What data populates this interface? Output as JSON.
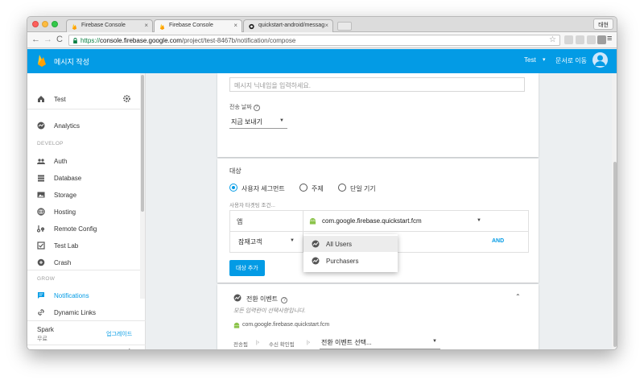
{
  "browser": {
    "tabs": [
      {
        "title": "Firebase Console"
      },
      {
        "title": "Firebase Console"
      },
      {
        "title": "quickstart-android/messag"
      }
    ],
    "profile": "태현",
    "url": {
      "scheme": "https://",
      "host": "console.firebase.google.com",
      "path": "/project/test-8467b/notification/compose"
    }
  },
  "appbar": {
    "title": "메시지 작성",
    "project": "Test",
    "docs_link": "문서로 이동"
  },
  "sidebar": {
    "project": "Test",
    "analytics": "Analytics",
    "develop_header": "DEVELOP",
    "develop_items": [
      {
        "label": "Auth"
      },
      {
        "label": "Database"
      },
      {
        "label": "Storage"
      },
      {
        "label": "Hosting"
      },
      {
        "label": "Remote Config"
      },
      {
        "label": "Test Lab"
      },
      {
        "label": "Crash"
      }
    ],
    "grow_header": "GROW",
    "grow_items": [
      {
        "label": "Notifications"
      },
      {
        "label": "Dynamic Links"
      }
    ],
    "plan_name": "Spark",
    "plan_price": "무료",
    "upgrade": "업그레이드",
    "collapse": "‹"
  },
  "compose": {
    "nickname_placeholder": "메시지 닉네임을 입력하세요.",
    "send_date_label": "전송 날짜",
    "send_date_value": "지금 보내기",
    "target_title": "대상",
    "target_options": [
      "사용자 세그먼트",
      "주제",
      "단일 기기"
    ],
    "target_selected": "사용자 세그먼트",
    "target_condition_label": "사용자 타겟팅 조건...",
    "app_label": "앱",
    "app_value": "com.google.firebase.quickstart.fcm",
    "audience_label": "잠재고객",
    "and_label": "AND",
    "add_target_button": "대상 추가",
    "audience_menu": [
      "All Users",
      "Purchasers"
    ],
    "conversion": {
      "title": "전환 이벤트",
      "subtitle": "모든 입력란이 선택사항입니다.",
      "app": "com.google.firebase.quickstart.fcm",
      "sent_label": "전송됨",
      "received_label": "수신 확인됨",
      "event_select": "전환 이벤트 선택..."
    }
  },
  "colors": {
    "brand_blue": "#039be5",
    "firebase_yellow": "#ffca28",
    "firebase_orange": "#ffa000"
  }
}
